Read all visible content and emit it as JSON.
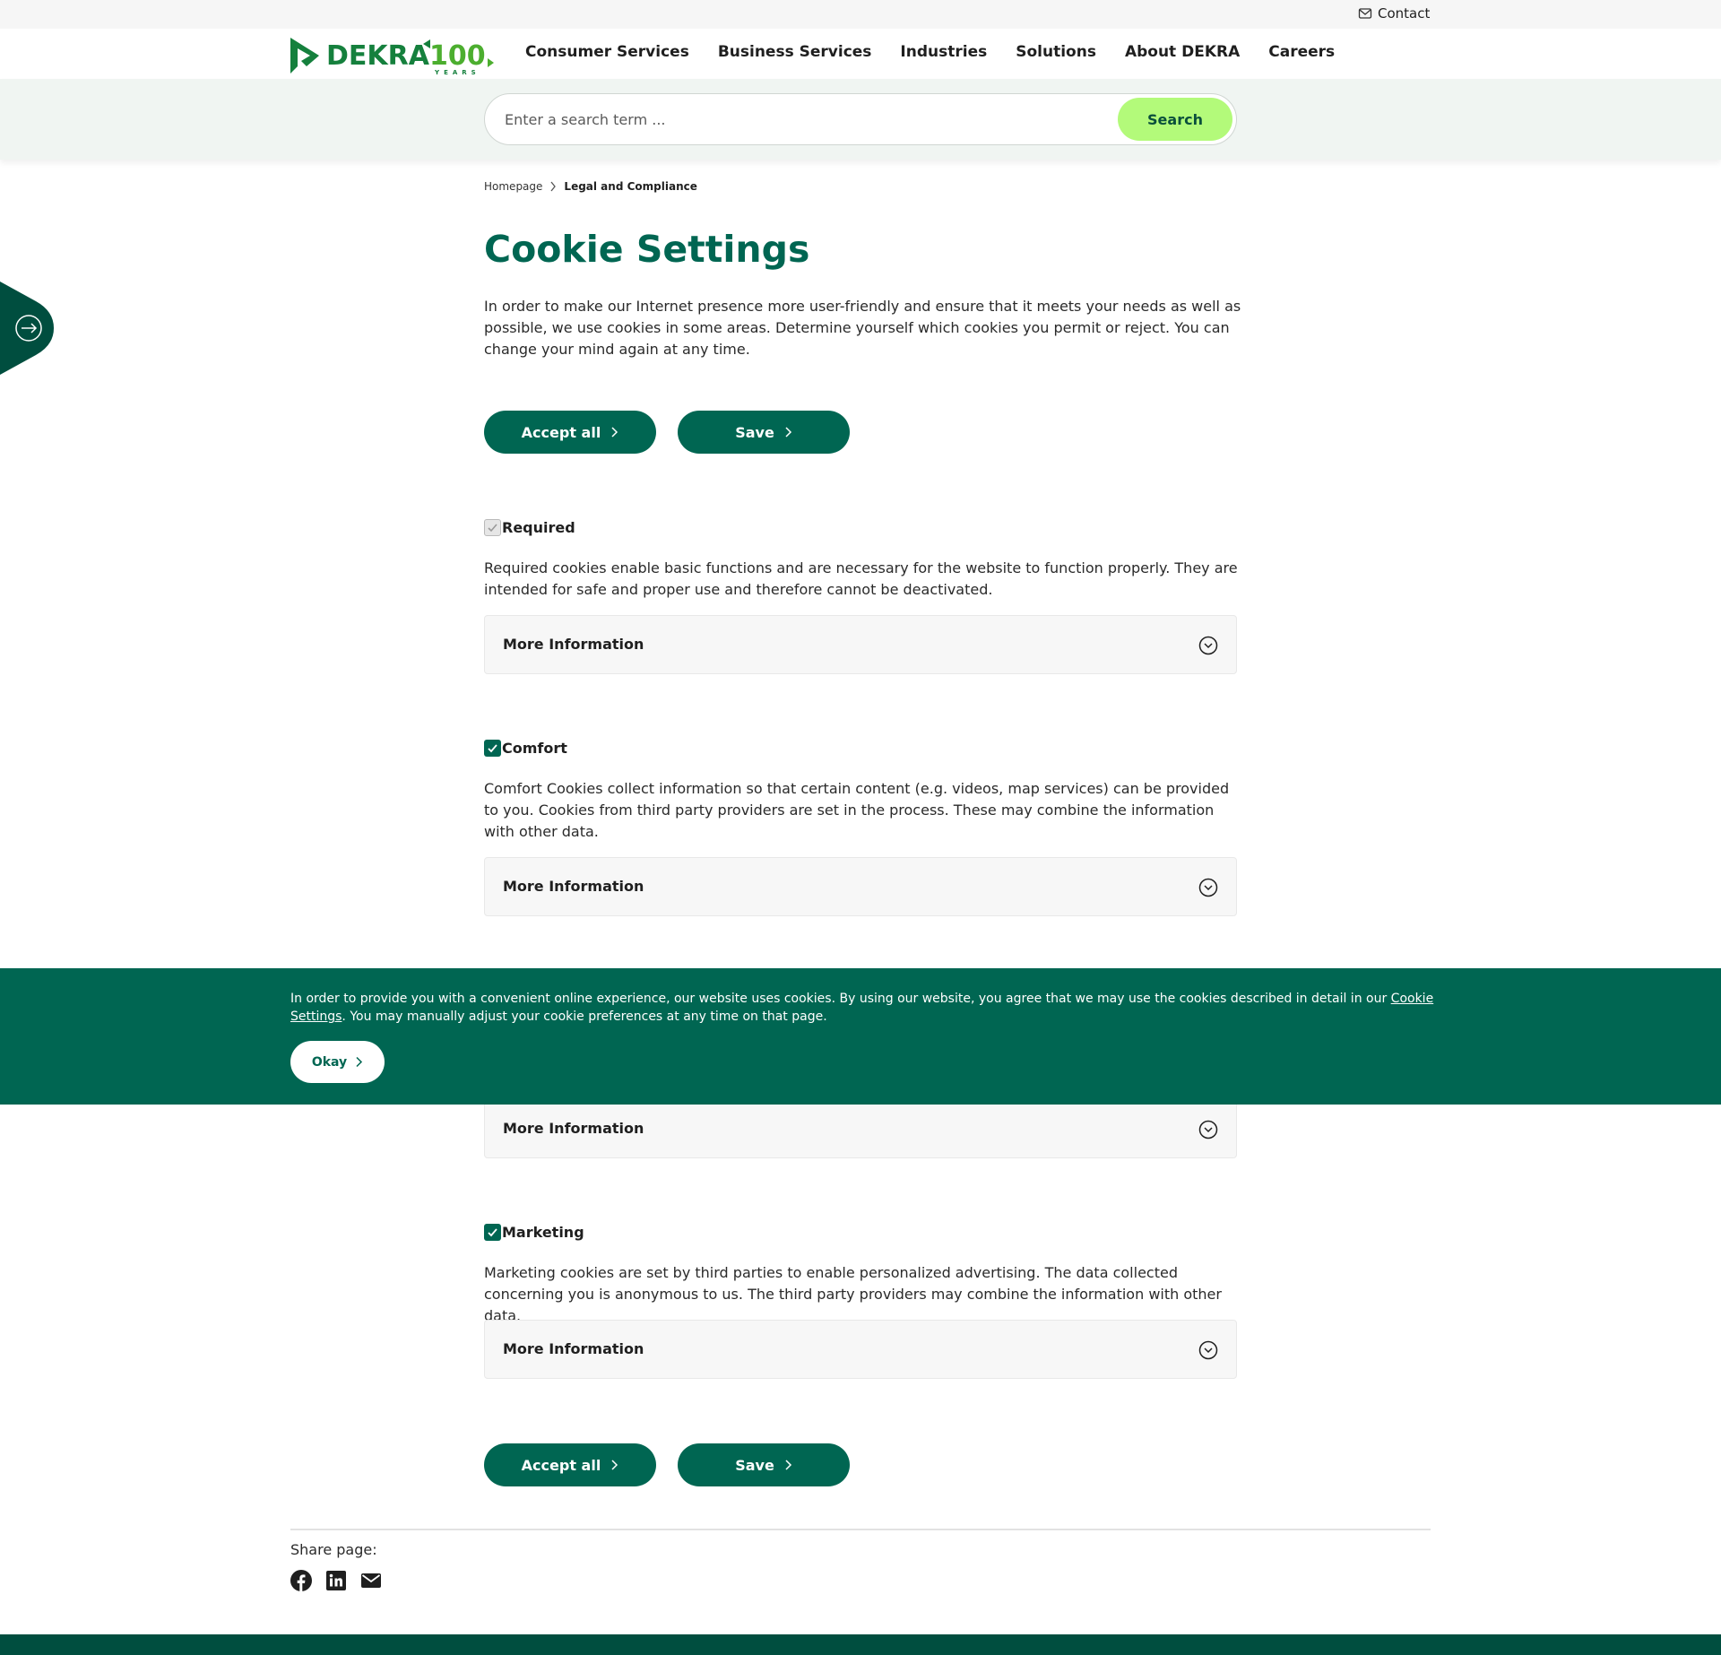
{
  "topbar": {
    "contact_label": "Contact",
    "contact_icon": "envelope-icon"
  },
  "header": {
    "logo_text": "DEKRA",
    "logo_badge": "100",
    "logo_sub": "YEARS",
    "nav": [
      {
        "label": "Consumer Services"
      },
      {
        "label": "Business Services"
      },
      {
        "label": "Industries"
      },
      {
        "label": "Solutions"
      },
      {
        "label": "About DEKRA"
      },
      {
        "label": "Careers"
      }
    ]
  },
  "search": {
    "placeholder": "Enter a search term ...",
    "button_label": "Search"
  },
  "breadcrumb": {
    "home": "Homepage",
    "current": "Legal and Compliance"
  },
  "main": {
    "title": "Cookie Settings",
    "intro": "In order to make our Internet presence more user-friendly and ensure that it meets your needs as well as possible, we use cookies in some areas. Determine yourself which cookies you permit or reject. You can change your mind again at any time.",
    "accept_all_label": "Accept all",
    "save_label": "Save",
    "more_info_label": "More Information",
    "categories": [
      {
        "label": "Required",
        "checked": true,
        "disabled": true,
        "description": "Required cookies enable basic functions and are necessary for the website to function properly. They are intended for safe and proper use and therefore cannot be deactivated."
      },
      {
        "label": "Comfort",
        "checked": true,
        "disabled": false,
        "description": "Comfort Cookies collect information so that certain content (e.g. videos, map services) can be provided to you. Cookies from third party providers are set in the process. These may combine the information with other data."
      },
      {
        "label": "Marketing",
        "checked": true,
        "disabled": false,
        "description": "Marketing cookies are set by third parties to enable personalized advertising. The data collected concerning you is anonymous to us. The third party providers may combine the information with other data."
      }
    ]
  },
  "banner": {
    "text_before": "In order to provide you with a convenient online experience, our website uses cookies. By using our website, you agree that we may use the cookies described in detail in our ",
    "link_label": "Cookie Settings",
    "text_after": ". You may manually adjust your cookie preferences at any time on that page.",
    "okay_label": "Okay"
  },
  "share": {
    "label": "Share page:",
    "icons": [
      "facebook-icon",
      "linkedin-icon",
      "email-icon"
    ]
  },
  "colors": {
    "brand_green": "#006652",
    "accent_lime": "#b3fa7a",
    "logo_green": "#15803d",
    "footer_green": "#004e3f"
  }
}
